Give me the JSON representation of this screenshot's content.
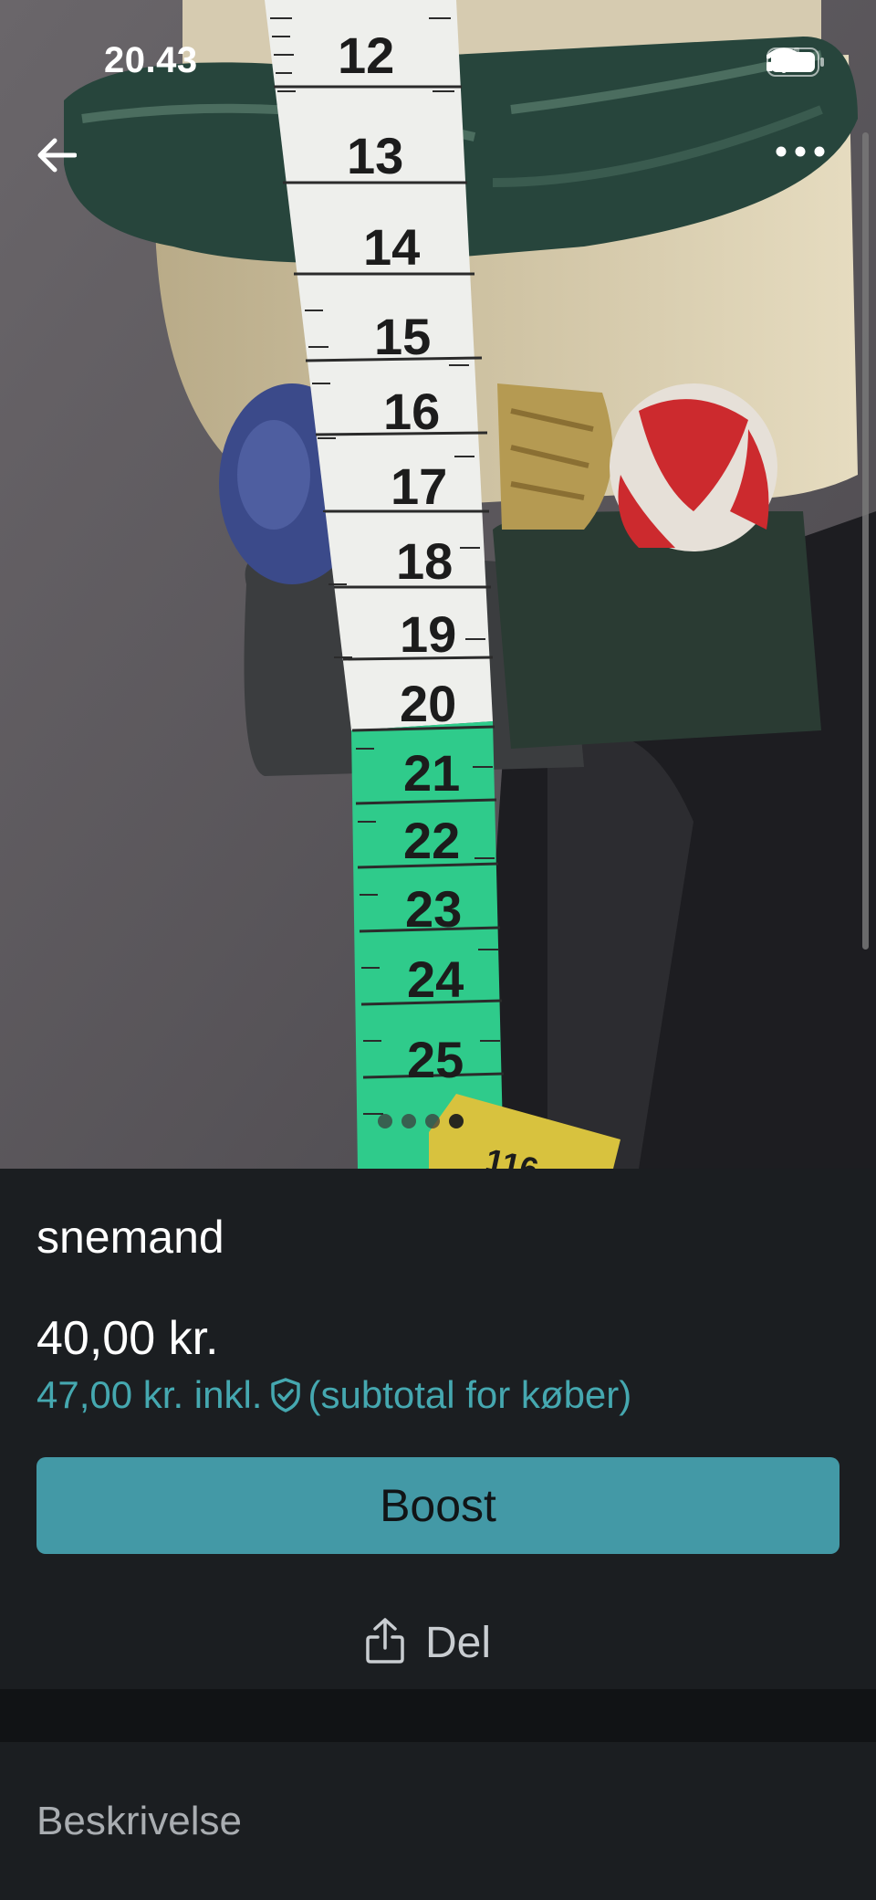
{
  "status_bar": {
    "time": "20.43"
  },
  "nav": {
    "back_icon": "arrow-left-icon",
    "more_icon": "more-horizontal-icon"
  },
  "gallery": {
    "page_count": 4,
    "active_page": 1
  },
  "listing": {
    "title": "snemand",
    "price": "40,00 kr.",
    "buyer_price_prefix": "47,00 kr. inkl.",
    "buyer_price_suffix": "(subtotal for køber)",
    "protection_icon": "shield-check-icon"
  },
  "actions": {
    "boost_label": "Boost",
    "share_label": "Del",
    "share_icon": "share-icon"
  },
  "description": {
    "heading": "Beskrivelse"
  },
  "colors": {
    "accent": "#4399a6",
    "accent_text": "#45a8b0",
    "background": "#1b1e21"
  }
}
